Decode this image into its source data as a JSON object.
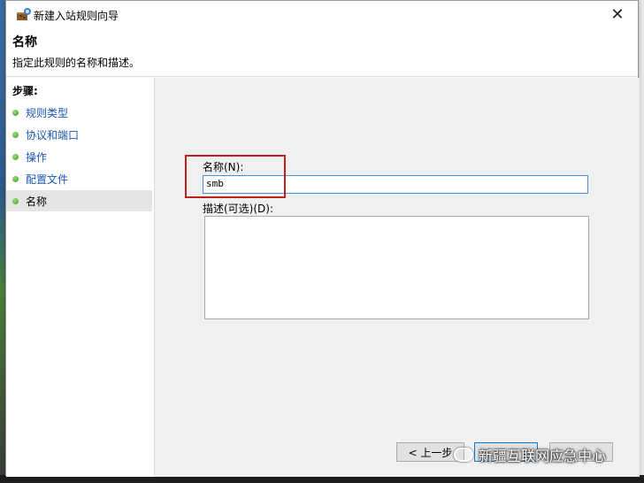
{
  "window": {
    "title": "新建入站规则向导",
    "close_glyph": "✕"
  },
  "header": {
    "title": "名称",
    "description": "指定此规则的名称和描述。"
  },
  "steps": {
    "title": "步骤:",
    "items": [
      {
        "label": "规则类型",
        "active": false
      },
      {
        "label": "协议和端口",
        "active": false
      },
      {
        "label": "操作",
        "active": false
      },
      {
        "label": "配置文件",
        "active": false
      },
      {
        "label": "名称",
        "active": true
      }
    ]
  },
  "form": {
    "name_label": "名称(N):",
    "name_value": "smb",
    "description_label": "描述(可选)(D):",
    "description_value": ""
  },
  "buttons": {
    "prev": "< 上一步",
    "finish": "",
    "cancel": ""
  },
  "watermark": {
    "text": "新疆互联网应急中心"
  },
  "colors": {
    "step_link": "#1a56b0",
    "highlight": "#c0201b",
    "input_border": "#4a90d9"
  }
}
